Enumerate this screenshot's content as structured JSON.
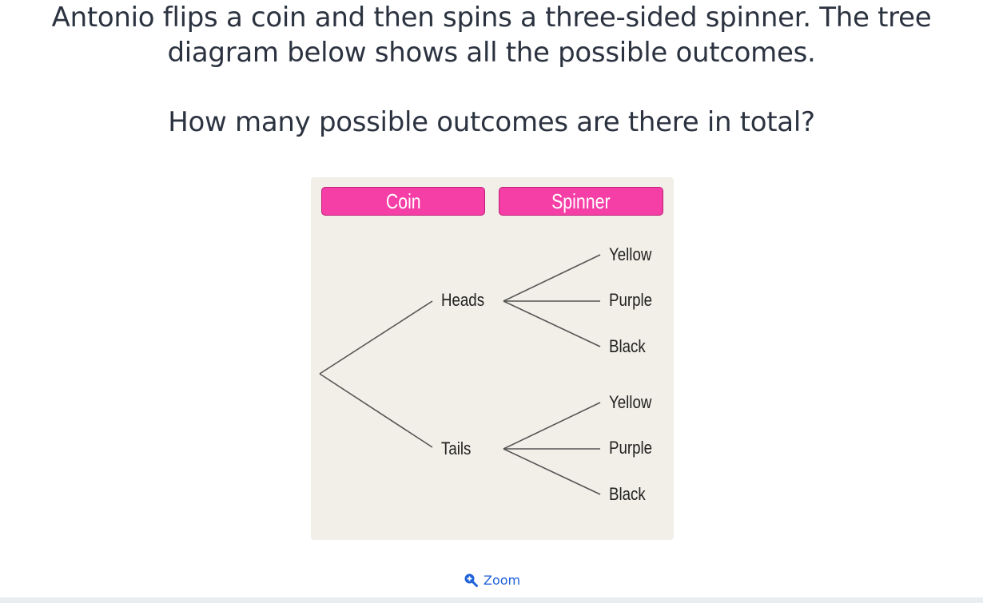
{
  "question": {
    "line1": "Antonio flips a coin and then spins a three-sided spinner. The tree",
    "line2": "diagram below shows all the possible outcomes.",
    "line3": "How many possible outcomes are there in total?"
  },
  "diagram": {
    "headers": {
      "coin": "Coin",
      "spinner": "Spinner"
    },
    "coin_outcomes": [
      "Heads",
      "Tails"
    ],
    "heads_outcomes": [
      "Yellow",
      "Purple",
      "Black"
    ],
    "tails_outcomes": [
      "Yellow",
      "Purple",
      "Black"
    ]
  },
  "zoom": {
    "label": "Zoom",
    "icon": "zoom-in-icon",
    "color": "#1f62d8"
  },
  "colors": {
    "header_fill": "#f53ea6",
    "panel_bg": "#f1efe7",
    "text": "#2c3340"
  }
}
